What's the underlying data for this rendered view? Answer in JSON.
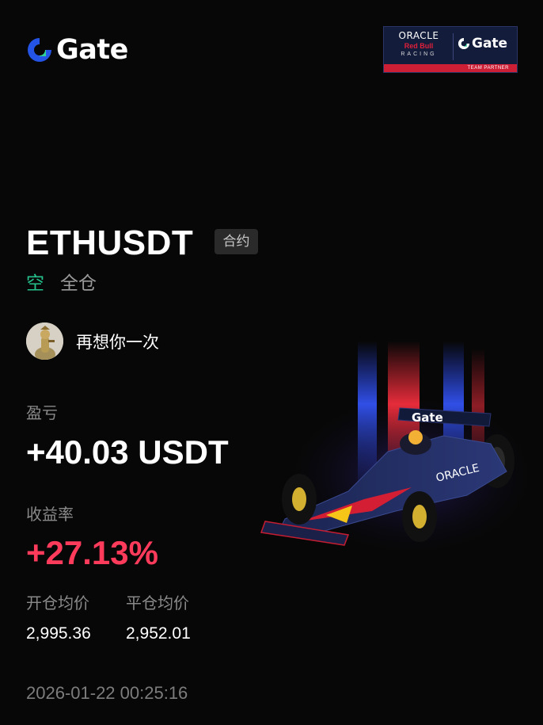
{
  "brand": {
    "name": "Gate",
    "accent_color": "#2354e6"
  },
  "partner_badge": {
    "oracle": "ORACLE",
    "red_bull": "Red Bull",
    "racing": "RACING",
    "gate": "Gate",
    "ribbon": "TEAM PARTNER"
  },
  "position": {
    "pair": "ETHUSDT",
    "contract_tag": "合约",
    "side": "空",
    "margin_mode": "全仓",
    "side_color": "#25c28b"
  },
  "user": {
    "name": "再想你一次",
    "avatar_icon": "avatar-icon"
  },
  "stats": {
    "pnl_label": "盈亏",
    "pnl_value": "+40.03 USDT",
    "roi_label": "收益率",
    "roi_value": "+27.13%",
    "roi_color": "#ff3b5c",
    "open_price_label": "开仓均价",
    "open_price_value": "2,995.36",
    "close_price_label": "平仓均价",
    "close_price_value": "2,952.01"
  },
  "timestamp": "2026-01-22 00:25:16",
  "art": {
    "car_logo": "Gate",
    "car_sponsor": "ORACLE"
  }
}
